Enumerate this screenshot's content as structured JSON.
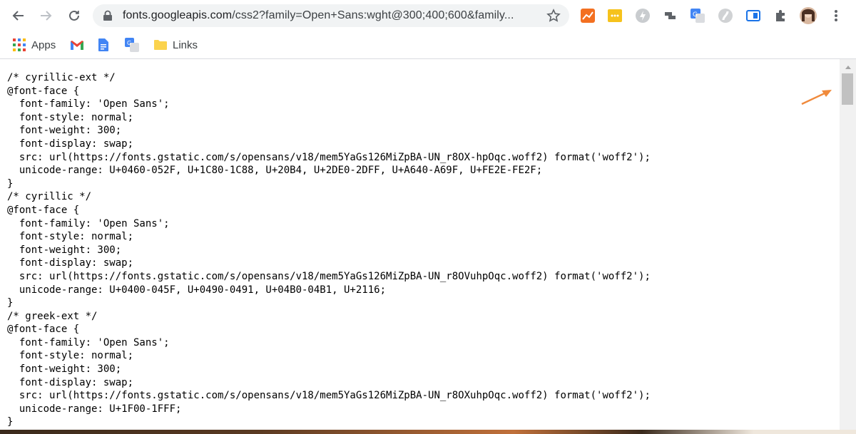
{
  "browser": {
    "url_host": "fonts.googleapis.com",
    "url_path": "/css2?family=Open+Sans:wght@300;400;600&family...",
    "back_icon": "arrow-left-icon",
    "forward_icon": "arrow-right-icon",
    "reload_icon": "reload-icon",
    "extensions": [
      "trend-chart-icon",
      "note-icon",
      "bolt-icon",
      "pin-tool-icon",
      "google-translate-icon",
      "extension-icon",
      "bookmark-tag-icon",
      "puzzle-icon",
      "profile-avatar"
    ]
  },
  "bookmarks": {
    "apps_label": "Apps",
    "links_label": "Links"
  },
  "code": {
    "lines": [
      "/* cyrillic-ext */",
      "@font-face {",
      "  font-family: 'Open Sans';",
      "  font-style: normal;",
      "  font-weight: 300;",
      "  font-display: swap;",
      "  src: url(https://fonts.gstatic.com/s/opensans/v18/mem5YaGs126MiZpBA-UN_r8OX-hpOqc.woff2) format('woff2');",
      "  unicode-range: U+0460-052F, U+1C80-1C88, U+20B4, U+2DE0-2DFF, U+A640-A69F, U+FE2E-FE2F;",
      "}",
      "/* cyrillic */",
      "@font-face {",
      "  font-family: 'Open Sans';",
      "  font-style: normal;",
      "  font-weight: 300;",
      "  font-display: swap;",
      "  src: url(https://fonts.gstatic.com/s/opensans/v18/mem5YaGs126MiZpBA-UN_r8OVuhpOqc.woff2) format('woff2');",
      "  unicode-range: U+0400-045F, U+0490-0491, U+04B0-04B1, U+2116;",
      "}",
      "/* greek-ext */",
      "@font-face {",
      "  font-family: 'Open Sans';",
      "  font-style: normal;",
      "  font-weight: 300;",
      "  font-display: swap;",
      "  src: url(https://fonts.gstatic.com/s/opensans/v18/mem5YaGs126MiZpBA-UN_r8OXuhpOqc.woff2) format('woff2');",
      "  unicode-range: U+1F00-1FFF;",
      "}"
    ]
  },
  "colors": {
    "annotation_arrow": "#f08a3c",
    "scrollbar_thumb": "#c1c1c1"
  }
}
